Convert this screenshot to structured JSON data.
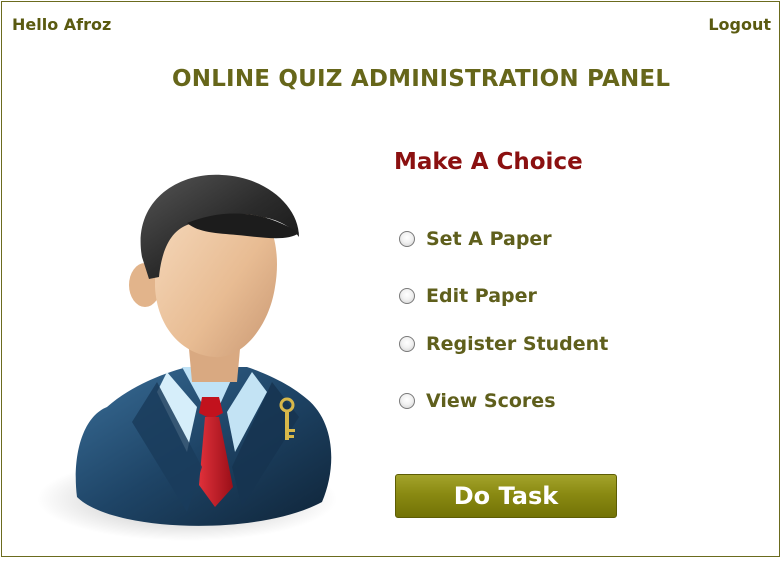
{
  "header": {
    "greeting": "Hello Afroz",
    "logout_label": "Logout"
  },
  "title": "ONLINE QUIZ ADMINISTRATION PANEL",
  "choice": {
    "heading": "Make A Choice",
    "options": [
      {
        "label": "Set A Paper",
        "selected": false
      },
      {
        "label": "Edit Paper",
        "selected": false
      },
      {
        "label": "Register Student",
        "selected": false
      },
      {
        "label": "View Scores",
        "selected": false
      }
    ]
  },
  "submit_label": "Do Task",
  "icons": {
    "avatar": "businessman-avatar-icon"
  },
  "colors": {
    "accent": "#6b6b1e",
    "heading": "#8b1010",
    "button": "#8a8a12"
  }
}
